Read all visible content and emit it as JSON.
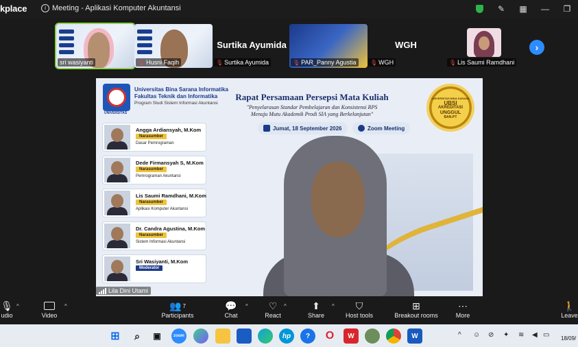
{
  "window": {
    "brand": "kplace",
    "title": "Meeting - Aplikasi Komputer Akuntansi"
  },
  "gallery": {
    "tiles": [
      {
        "name": "sri wasiyanti",
        "muted": false,
        "kind": "poster-video"
      },
      {
        "name": "Husni Faqih",
        "muted": true,
        "kind": "poster-video"
      },
      {
        "name": "Surtika Ayumida",
        "muted": true,
        "kind": "name-only",
        "display": "Surtika Ayumida"
      },
      {
        "name": "PAR_Panny Agustia",
        "muted": true,
        "kind": "poster"
      },
      {
        "name": "WGH",
        "muted": true,
        "kind": "name-only",
        "display": "WGH"
      },
      {
        "name": "Lis Saumi Ramdhani",
        "muted": true,
        "kind": "avatar"
      }
    ],
    "next_label": "›"
  },
  "poster": {
    "university": "Universitas Bina Sarana Informatika",
    "faculty": "Fakultas Teknik dan Informatika",
    "program": "Program Studi Sistem Informasi Akuntansi",
    "logo_caption": "UNIVERSITAS",
    "title": "Rapat Persamaan Persepsi Mata Kuliah",
    "subtitle_line1": "\"Penyelarasan Standar Pembelajaran dan Konsistensi RPS",
    "subtitle_line2": "Menuju Mutu Akademik Prodi SIA yang Berkelanjutan\"",
    "date": "Jumat, 18 September 2026",
    "platform": "Zoom Meeting",
    "seal": {
      "top": "UNIVERSITAS BINA SARANA",
      "mid": "UBSI",
      "line1": "AKREDITASI",
      "line2": "UNGGUL",
      "bottom": "BAN-PT"
    },
    "speakers": [
      {
        "name": "Angga Ardiansyah, M.Kom",
        "role": "Narasumber",
        "topic": "Dasar Pemrograman"
      },
      {
        "name": "Dede Firmansyah S, M.Kom",
        "role": "Narasumber",
        "topic": "Pemrograman Akuntansi"
      },
      {
        "name": "Lis Saumi Ramdhani, M.Kom",
        "role": "Narasumber",
        "topic": "Aplikasi Komputer Akuntansi"
      },
      {
        "name": "Dr. Candra Agustina, M.Kom",
        "role": "Narasumber",
        "topic": "Sistem Informasi Akuntansi"
      },
      {
        "name": "Sri Wasiyanti, M.Kom",
        "role": "Moderator",
        "topic": ""
      }
    ]
  },
  "active_speaker": "Lila Dini Utami",
  "toolbar": {
    "audio": "udio",
    "video": "Video",
    "participants": "Participants",
    "participants_count": "7",
    "chat": "Chat",
    "react": "React",
    "share": "Share",
    "host_tools": "Host tools",
    "breakout": "Breakout rooms",
    "more": "More",
    "leave": "Leave"
  },
  "taskbar": {
    "date": "18/09/"
  },
  "colors": {
    "accent": "#2d8cff",
    "active_outline": "#8bd34a",
    "muted": "#e0493f",
    "poster_navy": "#1b3a8a",
    "gold": "#f0c23a"
  }
}
